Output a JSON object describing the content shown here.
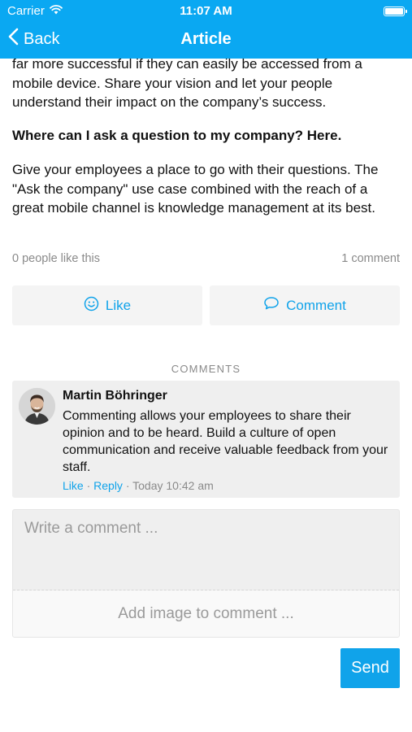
{
  "status_bar": {
    "carrier": "Carrier",
    "time": "11:07 AM",
    "icons": [
      "wifi-icon",
      "battery-icon"
    ]
  },
  "nav": {
    "back_label": "Back",
    "title": "Article"
  },
  "article": {
    "intro_paragraph": "far more successful if they can easily be accessed from a mobile device. Share your vision and let your people understand their impact on the company’s success.",
    "heading": "Where can I ask a question to my company? Here.",
    "paragraph": "Give your employees a place to go with their questions. The \"Ask the company\" use case combined with the reach of a great mobile channel is knowledge management at its best.",
    "likes_text": "0 people like this",
    "comment_count_text": "1 comment"
  },
  "actions": {
    "like_label": "Like",
    "comment_label": "Comment"
  },
  "comments": {
    "section_label": "COMMENTS",
    "items": [
      {
        "author": "Martin Böhringer",
        "text": "Commenting allows your employees to share their opinion and to be heard. Build a culture of open communication and receive valuable feedback from your staff.",
        "like_label": "Like",
        "reply_label": "Reply",
        "separator": "·",
        "timestamp": "Today 10:42 am"
      }
    ]
  },
  "composer": {
    "placeholder": "Write a comment ...",
    "add_image_label": "Add image to comment ...",
    "send_label": "Send"
  },
  "colors": {
    "brand": "#0aa8f2",
    "accent": "#10a3ea",
    "card_bg": "#efefef",
    "muted_text": "#8a8a8a"
  }
}
